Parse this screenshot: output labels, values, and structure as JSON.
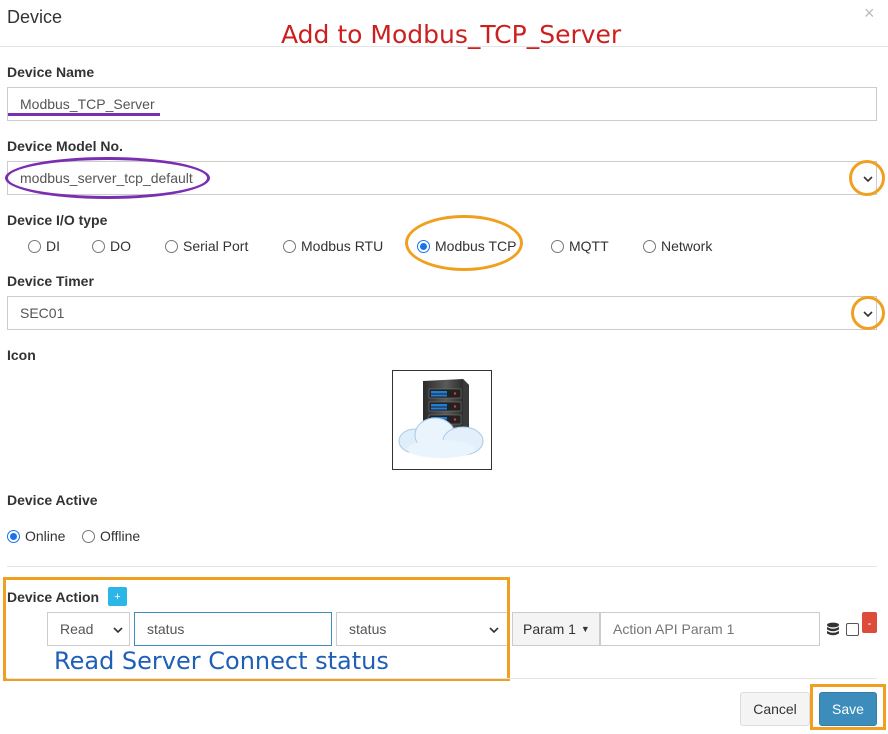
{
  "modal": {
    "title": "Device",
    "close": "×"
  },
  "annotations": {
    "header_note": "Add to Modbus_TCP_Server",
    "action_note": "Read Server Connect status"
  },
  "device_name": {
    "label": "Device Name",
    "value": "Modbus_TCP_Server"
  },
  "device_model": {
    "label": "Device Model No.",
    "value": "modbus_server_tcp_default"
  },
  "io_type": {
    "label": "Device I/O type",
    "options": [
      "DI",
      "DO",
      "Serial Port",
      "Modbus RTU",
      "Modbus TCP",
      "MQTT",
      "Network"
    ],
    "selected": "Modbus TCP"
  },
  "device_timer": {
    "label": "Device Timer",
    "value": "SEC01"
  },
  "icon": {
    "label": "Icon",
    "image": "server-cloud-icon"
  },
  "device_active": {
    "label": "Device Active",
    "options": [
      "Online",
      "Offline"
    ],
    "selected": "Online"
  },
  "device_action": {
    "label": "Device Action",
    "add": "+",
    "method": "Read",
    "name": "status",
    "command": "status",
    "param_button": "Param 1",
    "param_placeholder": "Action API Param 1",
    "remove": "-"
  },
  "footer": {
    "cancel": "Cancel",
    "save": "Save"
  },
  "colors": {
    "annotation_orange": "#f0a020",
    "annotation_purple": "#7a2fb0",
    "annotation_red": "#cc1f1f",
    "annotation_blue": "#1f5fb8",
    "primary": "#3c8dbc",
    "danger": "#dd4b39",
    "info": "#2bb6e8"
  }
}
